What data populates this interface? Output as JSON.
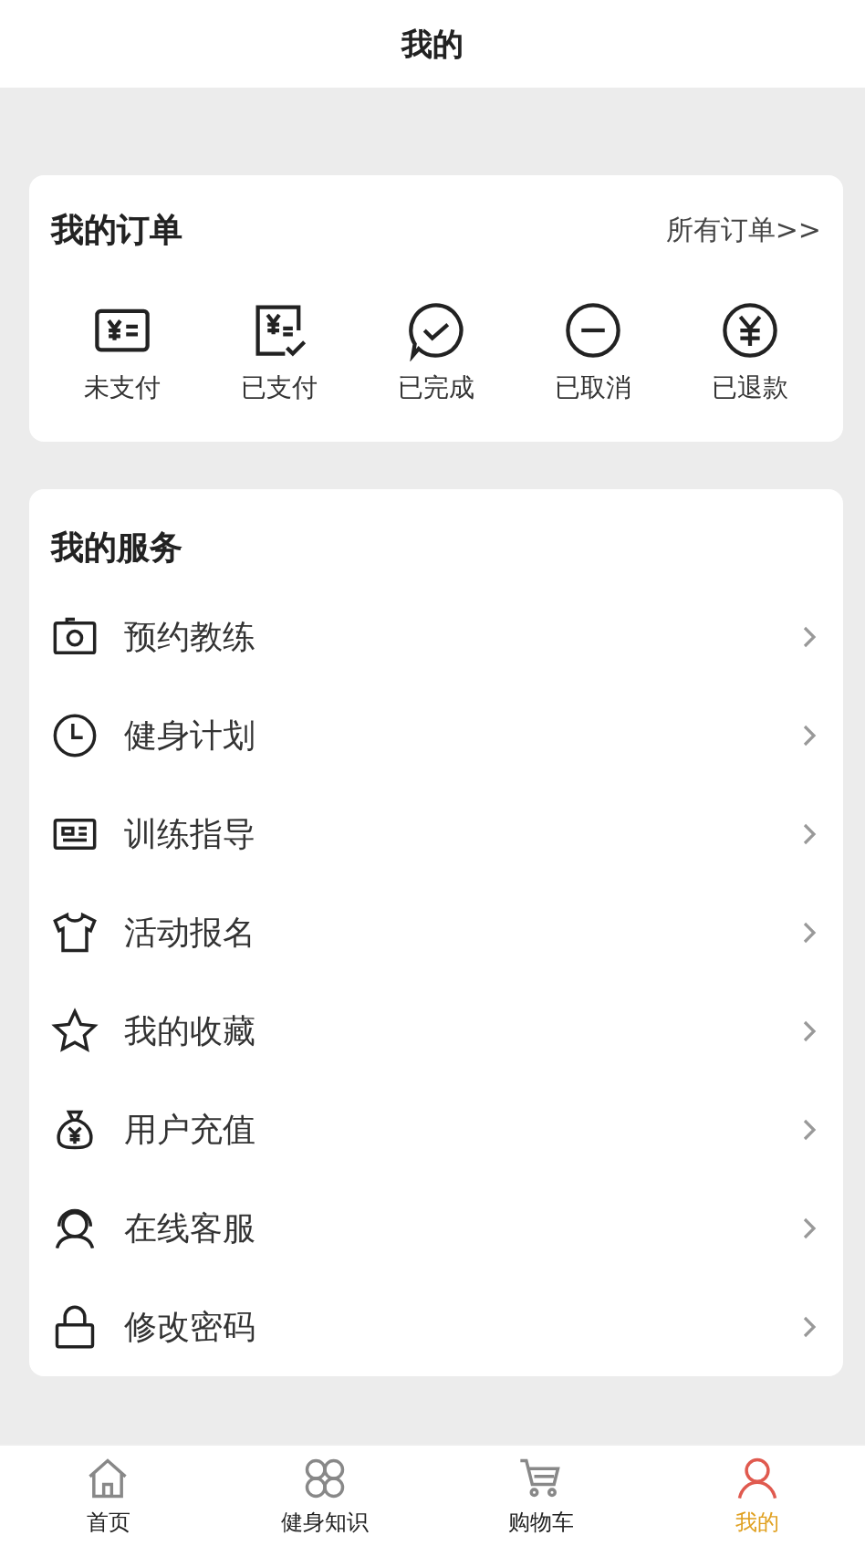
{
  "header": {
    "title": "我的"
  },
  "orders": {
    "title": "我的订单",
    "all_link": "所有订单>>",
    "statuses": [
      {
        "kind": "unpaid",
        "label": "未支付"
      },
      {
        "kind": "paid",
        "label": "已支付"
      },
      {
        "kind": "done",
        "label": "已完成"
      },
      {
        "kind": "cancelled",
        "label": "已取消"
      },
      {
        "kind": "refunded",
        "label": "已退款"
      }
    ]
  },
  "services": {
    "title": "我的服务",
    "items": [
      {
        "kind": "camera",
        "label": "预约教练"
      },
      {
        "kind": "clock",
        "label": "健身计划"
      },
      {
        "kind": "card",
        "label": "训练指导"
      },
      {
        "kind": "shirt",
        "label": "活动报名"
      },
      {
        "kind": "star",
        "label": "我的收藏"
      },
      {
        "kind": "moneybag",
        "label": "用户充值"
      },
      {
        "kind": "support",
        "label": "在线客服"
      },
      {
        "kind": "lock",
        "label": "修改密码"
      }
    ]
  },
  "tabbar": [
    {
      "kind": "home",
      "label": "首页",
      "selected": false
    },
    {
      "kind": "grid",
      "label": "健身知识",
      "selected": false
    },
    {
      "kind": "cart",
      "label": "购物车",
      "selected": false
    },
    {
      "kind": "user",
      "label": "我的",
      "selected": true
    }
  ]
}
